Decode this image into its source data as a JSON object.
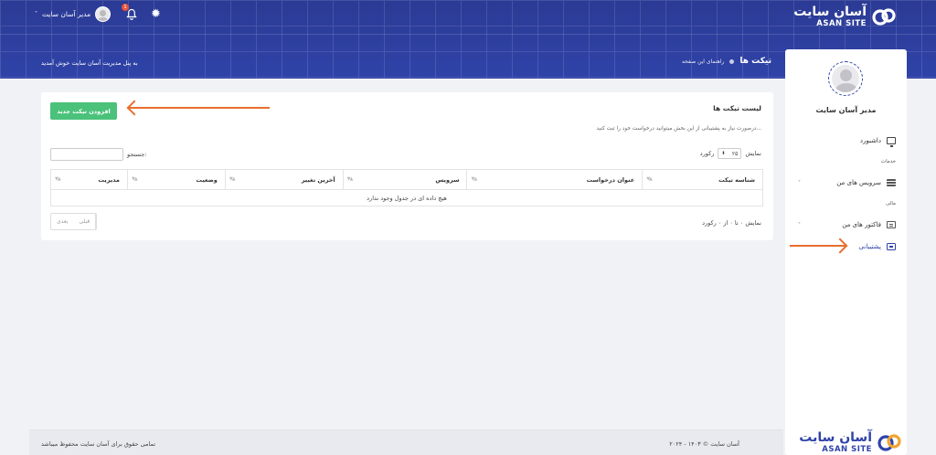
{
  "brand": {
    "fa": "آسان سایت",
    "en": "ASAN SITE",
    "color": "#2f43a8"
  },
  "header": {
    "user_name": "مدیر آسان سایت",
    "notification_count": "1",
    "page_title": "تیکت ها",
    "page_guide": "راهنمای این صفحه",
    "welcome": "به پنل مدیریت آسان سایت خوش آمدید"
  },
  "sidebar": {
    "user_name": "مدیر آسان سایت",
    "dashboard": "داشبورد",
    "cat_services": "خدمات",
    "my_services": "سرویس های من",
    "cat_finance": "مالی",
    "my_invoices": "فاکتور های من",
    "support": "پشتیبانی"
  },
  "tickets": {
    "title": "لیست تیکت ها",
    "description": "درصورت نیاز به پشتیبانی از این بخش میتوانید درخواست خود را ثبت کنید...",
    "add_button": "افزودن تیکت جدید",
    "show_label": "نمایش",
    "page_size": "۲۵",
    "records_label": "رکورد",
    "search_label": "جستجو:",
    "columns": [
      "شناسه تیکت",
      "عنوان درخواست",
      "سرویس",
      "آخرین تغییر",
      "وضعیت",
      "مدیریت"
    ],
    "empty_message": "هیچ داده ای در جدول وجود ندارد",
    "info": "نمایش ۰ تا ۰ از ۰ رکورد",
    "prev": "قبلی",
    "next": "بعدی"
  },
  "footer": {
    "copyright": "۲۰۲۴ - ۱۴۰۳ © آسان سایت",
    "rights": "تمامی حقوق برای آسان سایت محفوظ میباشد"
  },
  "colors": {
    "header": "#2f43a8",
    "add_button": "#4ac27a",
    "arrow": "#e86e2c",
    "badge": "#e5533d"
  }
}
